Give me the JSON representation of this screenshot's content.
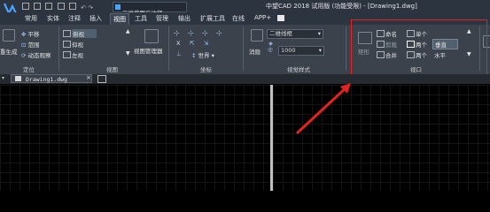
{
  "app": {
    "title": "中望CAD 2018 试用版 (功能受限) - [Drawing1.dwg]",
    "workspace": "二维草图与注释",
    "accent": "#e32222"
  },
  "tabs": [
    "常用",
    "实体",
    "注释",
    "插入",
    "视图",
    "工具",
    "管理",
    "输出",
    "扩展工具",
    "在线",
    "APP+"
  ],
  "active_tab": "视图",
  "ribbon": {
    "panels": {
      "position": {
        "label": "定位",
        "items": [
          "重生成",
          "平移",
          "范围",
          "动态观察"
        ]
      },
      "view": {
        "label": "视图",
        "items": [
          "俯视",
          "仰视",
          "左视"
        ],
        "manager": "视图管理器"
      },
      "coords": {
        "label": "坐标",
        "world": "世界",
        "x": "X"
      },
      "visual": {
        "label": "视觉样式",
        "style": "二维线框",
        "value": "1000",
        "icon_label": "消隐"
      },
      "viewport": {
        "label": "视口",
        "named": "命名",
        "clip": "剪裁",
        "join": "合并",
        "single": "单个",
        "two": "两个",
        "two2": "两个",
        "vertical": "垂直",
        "horizontal": "水平",
        "cut_left": "矩形"
      }
    }
  },
  "document": {
    "tab": "Drawing1.dwg"
  }
}
